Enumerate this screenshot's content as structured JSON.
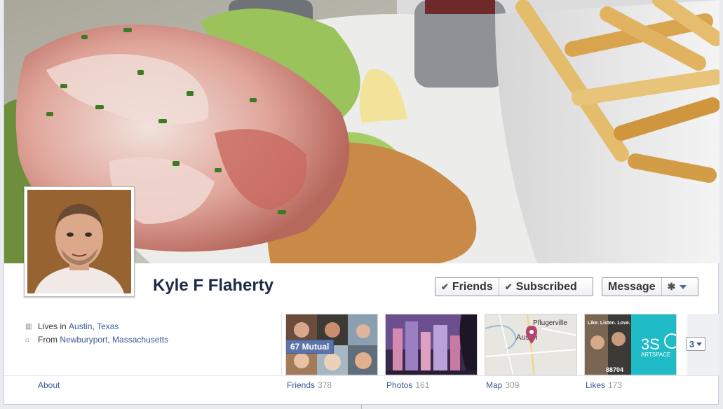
{
  "profile": {
    "name": "Kyle F Flaherty"
  },
  "actions": {
    "friends_label": "Friends",
    "subscribed_label": "Subscribed",
    "message_label": "Message"
  },
  "info": {
    "lives_prefix": "Lives in",
    "lives_city": "Austin",
    "lives_sep": ",",
    "lives_state": "Texas",
    "from_prefix": "From",
    "from_city": "Newburyport",
    "from_sep": ",",
    "from_state": "Massachusetts"
  },
  "thumbs": {
    "mutual_badge": "67 Mutual",
    "map_labels": {
      "town1": "Pflugerville",
      "town2": "Austin"
    },
    "likes_art_text": "3S",
    "likes_art_sub": "ARTSPACE",
    "likes_side_text": "Like. Listen. Love.",
    "likes_side_number": "88704"
  },
  "more": {
    "count": "3"
  },
  "nav": {
    "about": "About",
    "friends_label": "Friends",
    "friends_count": "378",
    "photos_label": "Photos",
    "photos_count": "161",
    "map_label": "Map",
    "map_count": "309",
    "likes_label": "Likes",
    "likes_count": "173"
  }
}
